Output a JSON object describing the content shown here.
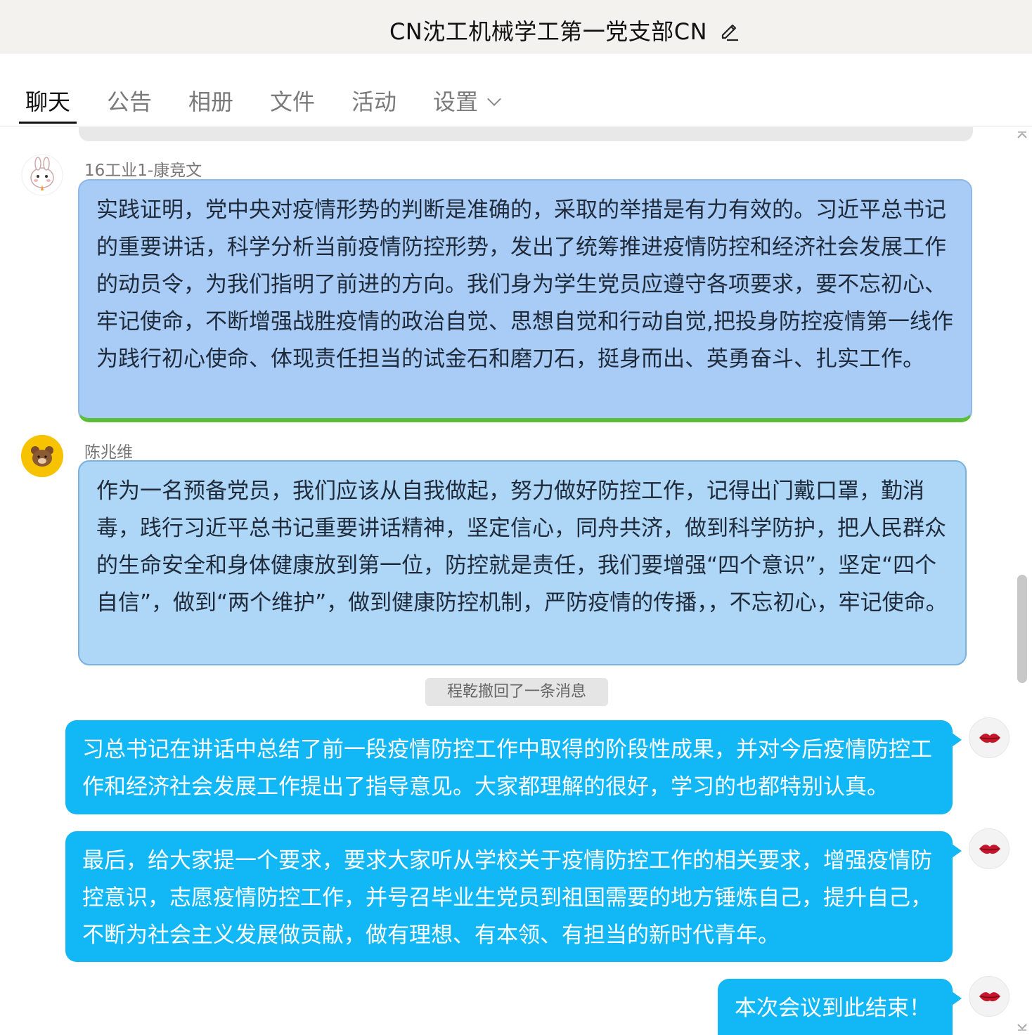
{
  "window": {
    "title": "CN沈工机械学工第一党支部CN"
  },
  "tabs": [
    {
      "label": "聊天"
    },
    {
      "label": "公告"
    },
    {
      "label": "相册"
    },
    {
      "label": "文件"
    },
    {
      "label": "活动"
    },
    {
      "label": "设置"
    }
  ],
  "messages": [
    {
      "sender": "16工业1-康竞文",
      "text": "实践证明，党中央对疫情形势的判断是准确的，采取的举措是有力有效的。习近平总书记的重要讲话，科学分析当前疫情防控形势，发出了统筹推进疫情防控和经济社会发展工作的动员令，为我们指明了前进的方向。我们身为学生党员应遵守各项要求，要不忘初心、牢记使命，不断增强战胜疫情的政治自觉、思想自觉和行动自觉,把投身防控疫情第一线作为践行初心使命、体现责任担当的试金石和磨刀石，挺身而出、英勇奋斗、扎实工作。"
    },
    {
      "sender": "陈兆维",
      "text": "作为一名预备党员，我们应该从自我做起，努力做好防控工作，记得出门戴口罩，勤消毒，践行习近平总书记重要讲话精神，坚定信心，同舟共济，做到科学防护，把人民群众的生命安全和身体健康放到第一位，防控就是责任，我们要增强“四个意识”，坚定“四个自信”，做到“两个维护”，做到健康防控机制，严防疫情的传播，，不忘初心，牢记使命。"
    }
  ],
  "recall_notice": "程乾撤回了一条消息",
  "own_messages": [
    {
      "text": "习总书记在讲话中总结了前一段疫情防控工作中取得的阶段性成果，并对今后疫情防控工作和经济社会发展工作提出了指导意见。大家都理解的很好，学习的也都特别认真。"
    },
    {
      "text": "最后，给大家提一个要求，要求大家听从学校关于疫情防控工作的相关要求，增强疫情防控意识，志愿疫情防控工作，并号召毕业生党员到祖国需要的地方锤炼自己，提升自己，不断为社会主义发展做贡献，做有理想、有本领、有担当的新时代青年。"
    },
    {
      "text": "本次会议到此结束！"
    }
  ],
  "colors": {
    "bubble_blue": "#a8ccf6",
    "bubble_light_blue": "#aed6f7",
    "own_bubble": "#12b7f5",
    "accent_green": "#5cbf3a"
  },
  "icons": [
    "edit-icon",
    "chevron-down-icon",
    "kiss-avatar",
    "rabbit-avatar",
    "bear-avatar",
    "scroll-up-icon",
    "scroll-down-icon"
  ]
}
